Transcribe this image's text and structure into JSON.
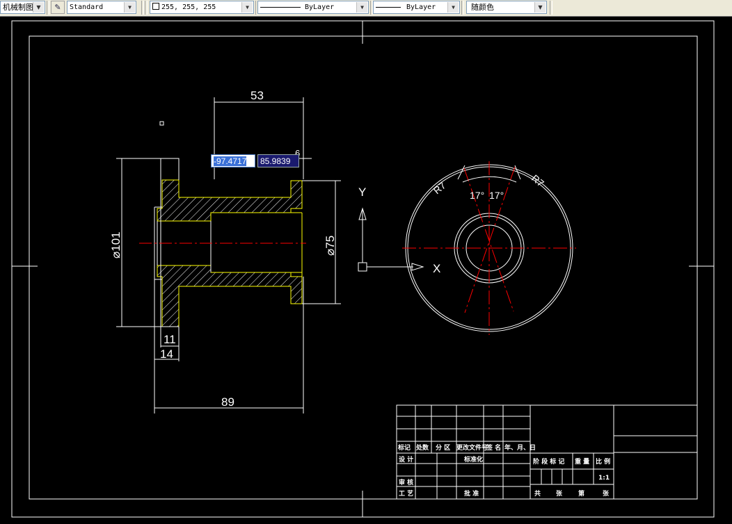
{
  "toolbar": {
    "style_combo": "机械制图样",
    "text_style": "Standard",
    "color": "255, 255, 255",
    "linetype": "ByLayer",
    "lineweight": "ByLayer",
    "plot_color": "随颜色"
  },
  "dynamic_input": {
    "x": "-97.4717",
    "y": "85.9839"
  },
  "dimensions": {
    "top_width": "53",
    "small_offset": "6",
    "outer_diameter": "⌀101",
    "inner_diameter": "⌀75",
    "flange_11": "11",
    "flange_14": "14",
    "total_length": "89",
    "angle_left": "17°",
    "angle_right": "17°",
    "radius_left": "R7",
    "radius_right": "R7"
  },
  "ucs": {
    "x_label": "X",
    "y_label": "Y"
  },
  "title_block": {
    "r1": [
      "标记",
      "处数",
      "分 区",
      "更改文件号",
      "签 名",
      "年、月、日"
    ],
    "design": "设 计",
    "standardize": "标准化",
    "review": "审 核",
    "process": "工 艺",
    "approve": "批 准",
    "stage_headers": [
      "阶 段 标 记",
      "重 量",
      "比 例"
    ],
    "scale": "1:1",
    "sheet_row": [
      "共",
      "张",
      "第",
      "张"
    ]
  }
}
